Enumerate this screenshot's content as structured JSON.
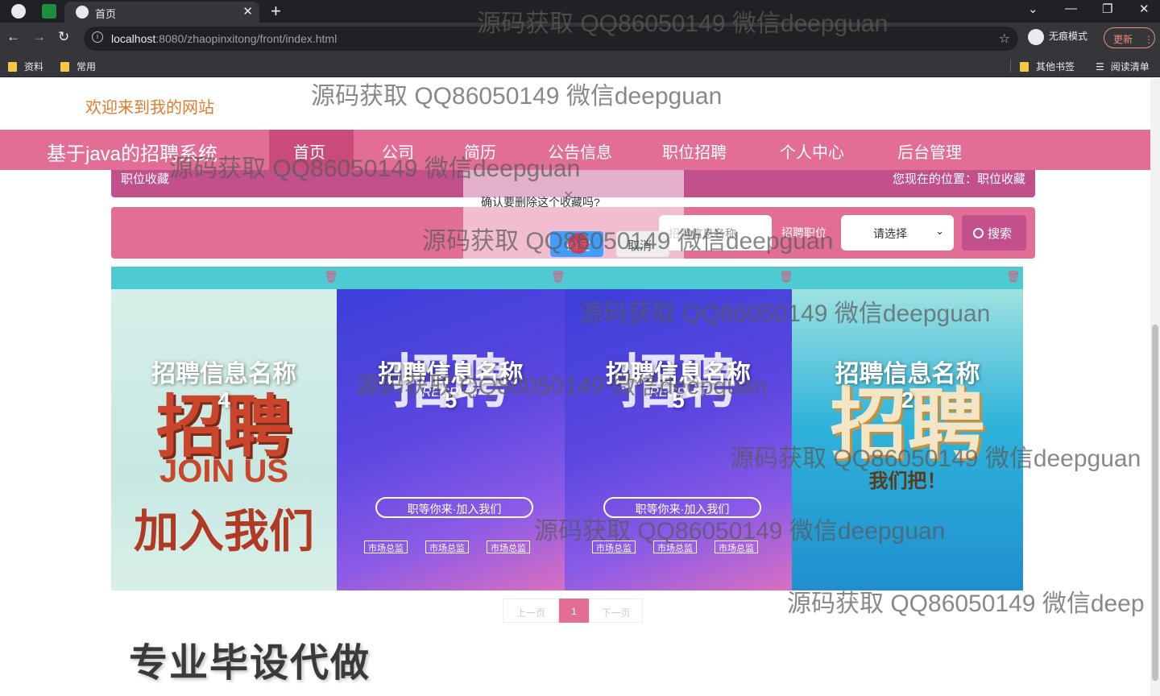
{
  "browser": {
    "tab_title": "首页",
    "new_tab_glyph": "+",
    "url_host": "localhost",
    "url_rest": ":8080/zhaopinxitong/front/index.html",
    "incognito_label": "无痕模式",
    "update_label": "更新",
    "bookmarks": [
      "资料",
      "常用"
    ],
    "bookmarks_right": [
      "其他书签",
      "阅读清单"
    ]
  },
  "site": {
    "welcome": "欢迎来到我的网站",
    "brand": "基于java的招聘系统",
    "nav": [
      "首页",
      "公司",
      "简历",
      "公告信息",
      "职位招聘",
      "个人中心",
      "后台管理"
    ],
    "active_nav": "首页",
    "accent_color": "#e26e96"
  },
  "breadcrumb": {
    "title": "职位收藏",
    "location": "您现在的位置：职位收藏"
  },
  "search": {
    "input_placeholder": "招聘信息名称",
    "label": "招聘职位",
    "select_value": "请选择",
    "button": "搜索"
  },
  "confirm": {
    "message": "确认要删除这个收藏吗?",
    "ok": "确定",
    "cancel": "取消"
  },
  "cards": [
    {
      "title": "招聘信息名称",
      "number": "4",
      "big": "招聘",
      "sub": "JOIN US",
      "sub2": "加入我们"
    },
    {
      "title": "招聘信息名称",
      "number": "5",
      "big": "招聘",
      "sub": "RECRUIT",
      "pill": "职等你来·加入我们",
      "tags": [
        "市场总监",
        "市场总监",
        "市场总监"
      ]
    },
    {
      "title": "招聘信息名称",
      "number": "5",
      "big": "招聘",
      "sub": "RECRUIT",
      "pill": "职等你来·加入我们",
      "tags": [
        "市场总监",
        "市场总监",
        "市场总监"
      ]
    },
    {
      "title": "招聘信息名称",
      "number": "2",
      "big": "招聘",
      "sub": "我们把！"
    }
  ],
  "pagination": {
    "prev": "上一页",
    "current": "1",
    "next": "下一页"
  },
  "promo": "专业毕设代做",
  "watermark": "源码获取 QQ86050149 微信deepguan",
  "watermark_cut": "源码获取 QQ86050149 微信deep"
}
